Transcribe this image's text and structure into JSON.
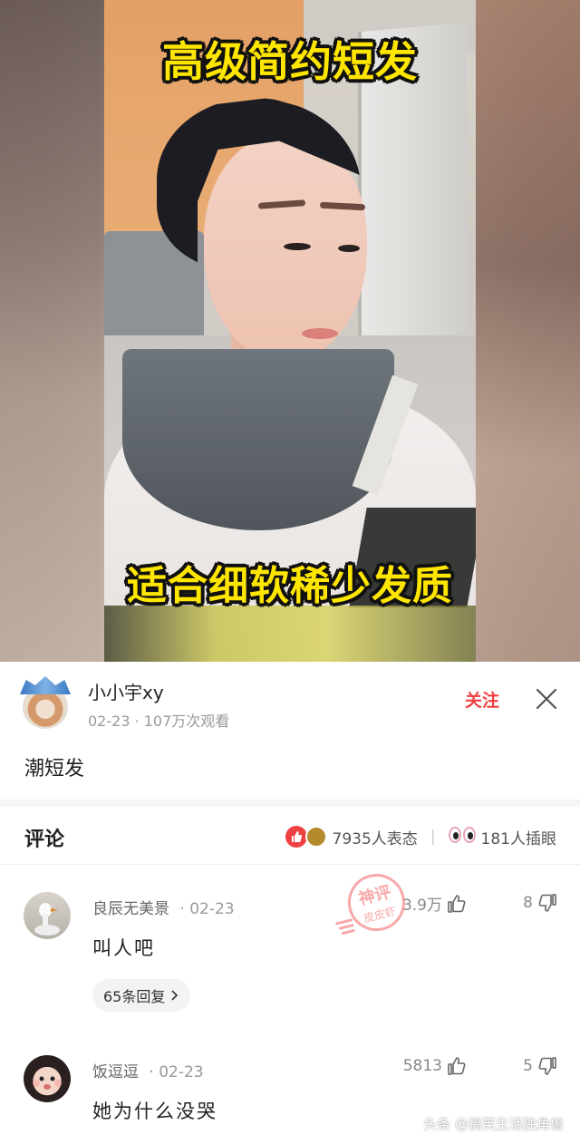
{
  "video": {
    "caption_top": "高级简约短发",
    "caption_bottom": "适合细软稀少发质"
  },
  "author": {
    "name": "小小宇xy",
    "meta": "02-23 · 107万次观看",
    "follow_label": "关注"
  },
  "post": {
    "text": "潮短发"
  },
  "comments_header": {
    "title": "评论",
    "reactions_text": "7935人表态",
    "insert_text": "181人插眼"
  },
  "comments": [
    {
      "name": "良辰无美景",
      "date": "· 02-23",
      "text": "叫人吧",
      "likes": "3.9万",
      "dislikes": "8",
      "replies": "65条回复"
    },
    {
      "name": "饭逗逗",
      "date": "· 02-23",
      "text": "她为什么没哭",
      "likes": "5813",
      "dislikes": "5"
    }
  ],
  "stamp": {
    "text": "神评",
    "subtext": "皮皮虾"
  },
  "watermark": {
    "text": "头条 @搞笑生活独角兽"
  },
  "colors": {
    "accent": "#f04142",
    "caption": "#ffe600"
  },
  "icons": [
    "close-icon",
    "thumbs-up-icon",
    "thumbs-down-icon",
    "chevron-right-icon",
    "like-reaction-icon",
    "eyes-reaction-icon"
  ]
}
